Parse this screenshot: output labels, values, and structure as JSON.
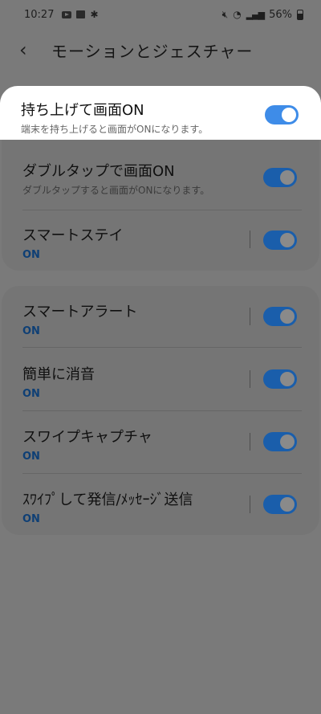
{
  "status_bar": {
    "time": "10:27",
    "battery": "56%",
    "icons_left": [
      "youtube-icon",
      "gallery-icon",
      "gear-icon"
    ],
    "icons_right": [
      "mute-icon",
      "wifi-icon",
      "signal-icon",
      "battery-icon"
    ]
  },
  "header": {
    "back_icon": "chevron-left-icon",
    "title": "モーションとジェスチャー"
  },
  "section1": {
    "items": [
      {
        "label": "持ち上げて画面ON",
        "sub": "端末を持ち上げると画面がONになります。",
        "enabled": true,
        "highlighted": true
      },
      {
        "label": "ダブルタップで画面ON",
        "sub": "ダブルタップすると画面がONになります。",
        "enabled": true
      },
      {
        "label": "スマートステイ",
        "status": "ON",
        "enabled": true
      }
    ]
  },
  "section2": {
    "items": [
      {
        "label": "スマートアラート",
        "status": "ON",
        "enabled": true
      },
      {
        "label": "簡単に消音",
        "status": "ON",
        "enabled": true
      },
      {
        "label": "スワイプキャプチャ",
        "status": "ON",
        "enabled": true
      },
      {
        "label": "ｽﾜｲﾌﾟして発信/ﾒｯｾｰｼﾞ送信",
        "status": "ON",
        "enabled": true
      }
    ]
  },
  "colors": {
    "accent": "#3e8ce8",
    "dimmed_accent": "#1a5eab",
    "overlay_background": "#7a7a7a"
  }
}
